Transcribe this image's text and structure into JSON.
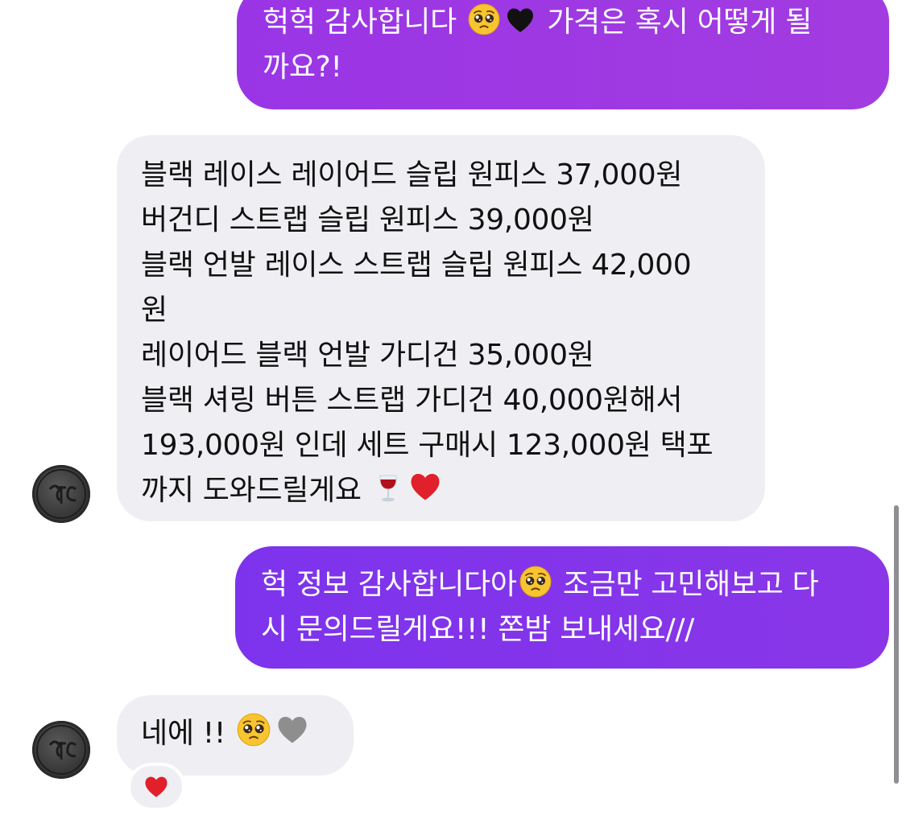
{
  "conversation": {
    "messages": [
      {
        "direction": "outgoing",
        "lines": [
          "헉헉 감사합니다",
          "가격은 혹시 어떻게 될",
          "까요?!"
        ],
        "emojis": [
          "pleading-face-emoji",
          "black-heart-emoji"
        ]
      },
      {
        "direction": "incoming",
        "lines": [
          "블랙 레이스 레이어드 슬립 원피스 37,000원",
          "버건디 스트랩 슬립 원피스 39,000원",
          "블랙 언발 레이스 스트랩 슬립 원피스 42,000",
          "원",
          "레이어드 블랙 언발 가디건 35,000원",
          "블랙 셔링 버튼 스트랩 가디건 40,000원해서",
          "193,000원 인데 세트 구매시 123,000원 택포",
          "까지 도와드릴게요"
        ],
        "emojis": [
          "wine-glass-emoji",
          "red-heart-emoji"
        ]
      },
      {
        "direction": "outgoing",
        "lines": [
          "헉 정보 감사합니다아",
          "조금만 고민해보고 다",
          "시 문의드릴게요!!! 쫀밤 보내세요///"
        ],
        "emojis": [
          "pleading-face-emoji"
        ]
      },
      {
        "direction": "incoming",
        "lines": [
          "네에 !!"
        ],
        "emojis": [
          "pleading-face-emoji",
          "grey-heart-emoji"
        ],
        "reaction": "red-heart-emoji"
      }
    ]
  },
  "colors": {
    "outgoing_bubble_top": "#9a35e6",
    "outgoing_bubble_mid": "#7d33ec",
    "incoming_bubble": "#efeff3",
    "heart_red": "#e0202a",
    "heart_black": "#111111",
    "heart_grey": "#8e8e8e",
    "emoji_yellow": "#f7c531"
  }
}
